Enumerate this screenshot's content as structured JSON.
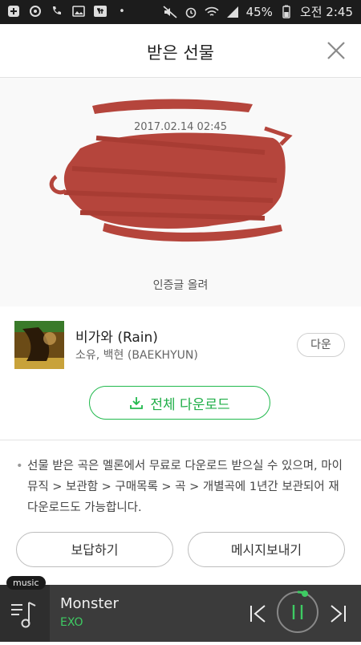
{
  "status": {
    "battery": "45%",
    "time": "오전 2:45"
  },
  "header": {
    "title": "받은 선물"
  },
  "gift": {
    "date": "2017.02.14 02:45",
    "message": "인증글 올려"
  },
  "song": {
    "title": "비가와 (Rain)",
    "artist": "소유, 백현 (BAEKHYUN)",
    "download_label": "다운"
  },
  "download_all_label": "전체 다운로드",
  "notice": "선물 받은 곡은 멜론에서 무료로 다운로드 받으실 수 있으며, 마이뮤직 > 보관함 > 구매목록 > 곡 > 개별곡에 1년간 보관되어 재 다운로드도 가능합니다.",
  "actions": {
    "reply_label": "보답하기",
    "message_label": "메시지보내기"
  },
  "player": {
    "badge": "music",
    "title": "Monster",
    "artist": "EXO"
  },
  "colors": {
    "accent": "#21b94d",
    "redaction": "#b5453c"
  }
}
